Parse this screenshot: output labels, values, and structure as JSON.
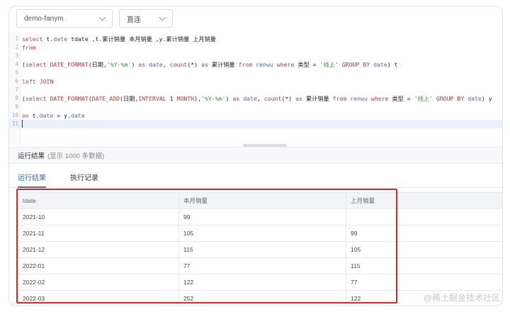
{
  "toolbar": {
    "database_select": "demo-fanym",
    "mode_select": "直连"
  },
  "editor": {
    "lines": [
      {
        "n": "1",
        "text": "select t.date tdate ,t.累计销量 本月销量 ,y.累计销量 上月销量"
      },
      {
        "n": "2",
        "text": "from"
      },
      {
        "n": "3",
        "text": ""
      },
      {
        "n": "4",
        "text": "(select DATE_FORMAT(日期,'%Y-%m') as date, count(*) as 累计销量 from renwu where 类型 = '线上' GROUP BY date) t"
      },
      {
        "n": "5",
        "text": ""
      },
      {
        "n": "6",
        "text": "left JOIN"
      },
      {
        "n": "7",
        "text": ""
      },
      {
        "n": "8",
        "text": "(select DATE_FORMAT(DATE_ADD(日期,INTERVAL 1 MONTH),'%Y-%m') as date, count(*) as 累计销量 from renwu where 类型 = '线上' GROUP BY date) y"
      },
      {
        "n": "9",
        "text": ""
      },
      {
        "n": "10",
        "text": "on t.date = y.date"
      },
      {
        "n": "11",
        "text": ""
      }
    ]
  },
  "results_panel": {
    "title": "运行结果",
    "subtitle": "(显示 1000 条数据)"
  },
  "tabs": {
    "result": "运行结果",
    "history": "执行记录"
  },
  "table": {
    "columns": [
      "tdate",
      "本月销量",
      "上月销量"
    ],
    "rows": [
      [
        "2021-10",
        "99",
        ""
      ],
      [
        "2021-11",
        "105",
        "99"
      ],
      [
        "2021-12",
        "115",
        "105"
      ],
      [
        "2022-01",
        "77",
        "115"
      ],
      [
        "2022-02",
        "122",
        "77"
      ],
      [
        "2022-03",
        "252",
        "122"
      ]
    ]
  },
  "watermark": "@稀土掘金技术社区",
  "colors": {
    "accent": "#2f6fdc",
    "highlight_box": "#e0262c"
  }
}
